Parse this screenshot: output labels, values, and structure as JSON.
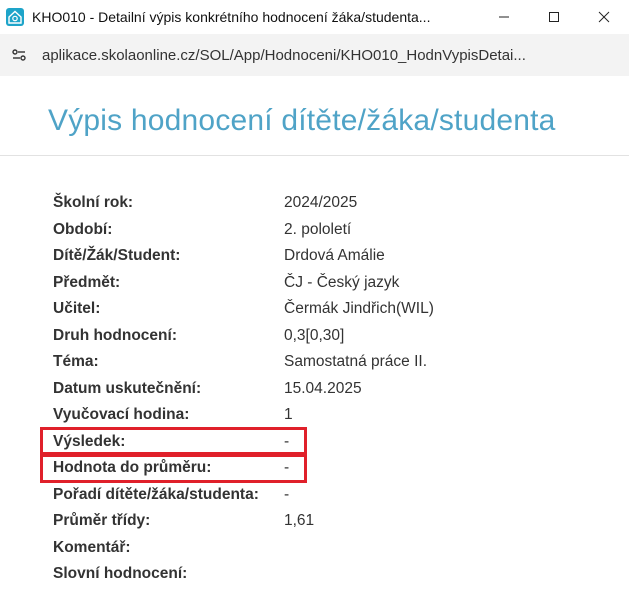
{
  "window": {
    "title": "KHO010 - Detailní výpis konkrétního hodnocení žáka/studenta...",
    "controls": [
      "minimize-icon",
      "maximize-icon",
      "close-icon"
    ]
  },
  "address_bar": {
    "url": "aplikace.skolaonline.cz/SOL/App/Hodnoceni/KHO010_HodnVypisDetai..."
  },
  "page": {
    "title": "Výpis hodnocení dítěte/žáka/studenta"
  },
  "details": [
    {
      "label": "Školní rok:",
      "value": "2024/2025"
    },
    {
      "label": "Období:",
      "value": "2. pololetí"
    },
    {
      "label": "Dítě/Žák/Student:",
      "value": "Drdová Amálie"
    },
    {
      "label": "Předmět:",
      "value": "ČJ - Český jazyk"
    },
    {
      "label": "Učitel:",
      "value": "Čermák Jindřich(WIL)"
    },
    {
      "label": "Druh hodnocení:",
      "value": "0,3[0,30]"
    },
    {
      "label": "Téma:",
      "value": "Samostatná práce II."
    },
    {
      "label": "Datum uskutečnění:",
      "value": "15.04.2025"
    },
    {
      "label": "Vyučovací hodina:",
      "value": "1"
    },
    {
      "label": "Výsledek:",
      "value": "-"
    },
    {
      "label": "Hodnota do průměru:",
      "value": "-"
    },
    {
      "label": "Pořadí dítěte/žáka/studenta:",
      "value": "-"
    },
    {
      "label": "Průměr třídy:",
      "value": "1,61"
    },
    {
      "label": "Komentář:",
      "value": ""
    },
    {
      "label": "Slovní hodnocení:",
      "value": ""
    }
  ],
  "colors": {
    "title": "#4fa3c7",
    "highlight_border": "#e0202a",
    "app_icon": "#1ea4c9"
  }
}
